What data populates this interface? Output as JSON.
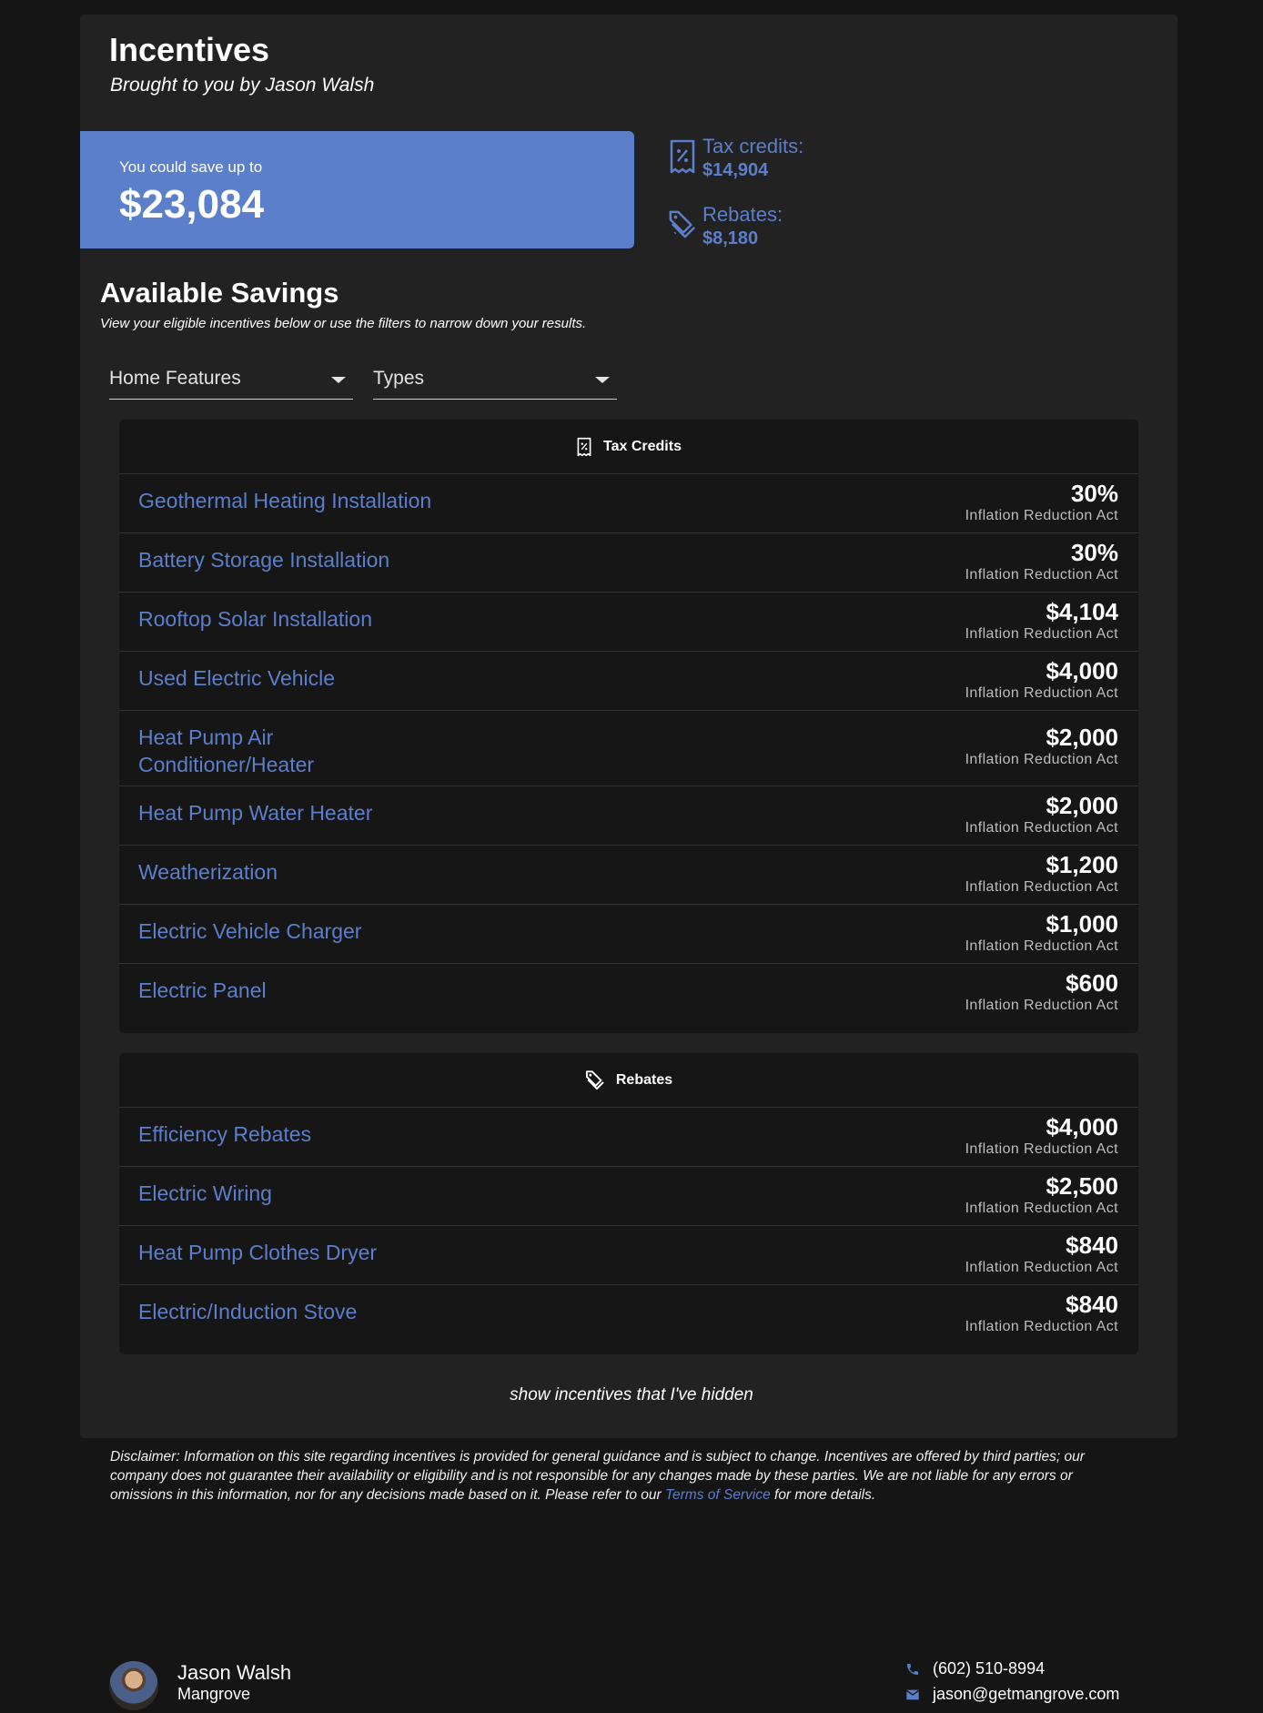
{
  "header": {
    "title": "Incentives",
    "subtitle": "Brought to you by Jason Walsh"
  },
  "savings": {
    "label": "You could save up to",
    "amount": "$23,084"
  },
  "summary": {
    "tax_credits_label": "Tax credits:",
    "tax_credits_value": "$14,904",
    "rebates_label": "Rebates:",
    "rebates_value": "$8,180"
  },
  "available": {
    "title": "Available Savings",
    "subtitle": "View your eligible incentives below or use the filters to narrow down your results."
  },
  "filters": {
    "home_features": "Home Features",
    "types": "Types"
  },
  "tax_credits": {
    "heading": "Tax Credits",
    "items": [
      {
        "name": "Geothermal Heating Installation",
        "amount": "30%",
        "source": "Inflation Reduction Act"
      },
      {
        "name": "Battery Storage Installation",
        "amount": "30%",
        "source": "Inflation Reduction Act"
      },
      {
        "name": "Rooftop Solar Installation",
        "amount": "$4,104",
        "source": "Inflation Reduction Act"
      },
      {
        "name": "Used Electric Vehicle",
        "amount": "$4,000",
        "source": "Inflation Reduction Act"
      },
      {
        "name": "Heat Pump Air Conditioner/Heater",
        "amount": "$2,000",
        "source": "Inflation Reduction Act"
      },
      {
        "name": "Heat Pump Water Heater",
        "amount": "$2,000",
        "source": "Inflation Reduction Act"
      },
      {
        "name": "Weatherization",
        "amount": "$1,200",
        "source": "Inflation Reduction Act"
      },
      {
        "name": "Electric Vehicle Charger",
        "amount": "$1,000",
        "source": "Inflation Reduction Act"
      },
      {
        "name": "Electric Panel",
        "amount": "$600",
        "source": "Inflation Reduction Act"
      }
    ]
  },
  "rebates": {
    "heading": "Rebates",
    "items": [
      {
        "name": "Efficiency Rebates",
        "amount": "$4,000",
        "source": "Inflation Reduction Act"
      },
      {
        "name": "Electric Wiring",
        "amount": "$2,500",
        "source": "Inflation Reduction Act"
      },
      {
        "name": "Heat Pump Clothes Dryer",
        "amount": "$840",
        "source": "Inflation Reduction Act"
      },
      {
        "name": "Electric/Induction Stove",
        "amount": "$840",
        "source": "Inflation Reduction Act"
      }
    ]
  },
  "show_hidden": "show incentives that I've hidden",
  "disclaimer": {
    "before": "Disclaimer: Information on this site regarding incentives is provided for general guidance and is subject to change. Incentives are offered by third parties; our company does not guarantee their availability or eligibility and is not responsible for any changes made by these parties. We are not liable for any errors or omissions in this information, nor for any decisions made based on it. Please refer to our ",
    "link": "Terms of Service",
    "after": " for more details."
  },
  "footer": {
    "agent_name": "Jason Walsh",
    "company": "Mangrove",
    "phone": "(602) 510-8994",
    "email": "jason@getmangrove.com"
  },
  "colors": {
    "accent": "#5b7fcb",
    "panel": "#222222",
    "background": "#151515",
    "card": "#161616"
  }
}
